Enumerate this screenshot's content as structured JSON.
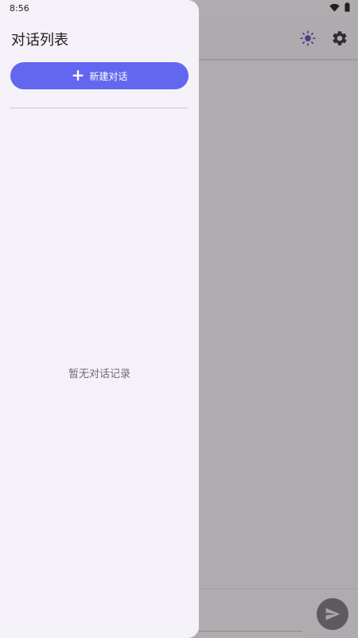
{
  "status_bar": {
    "time": "8:56",
    "icons": [
      "wifi-icon",
      "battery-icon"
    ]
  },
  "drawer": {
    "title": "对话列表",
    "new_chat_label": "新建对话",
    "new_chat_icon": "plus-icon",
    "empty_text": "暂无对话记录"
  },
  "app_bar": {
    "actions": [
      "brightness-icon",
      "settings-icon"
    ]
  },
  "composer": {
    "input_value": "",
    "send_icon": "send-icon"
  },
  "colors": {
    "accent": "#6366ee",
    "drawer_bg": "#f5f1f8",
    "scrim_bg": "#afabaf",
    "send_button": "#5e5b60"
  }
}
